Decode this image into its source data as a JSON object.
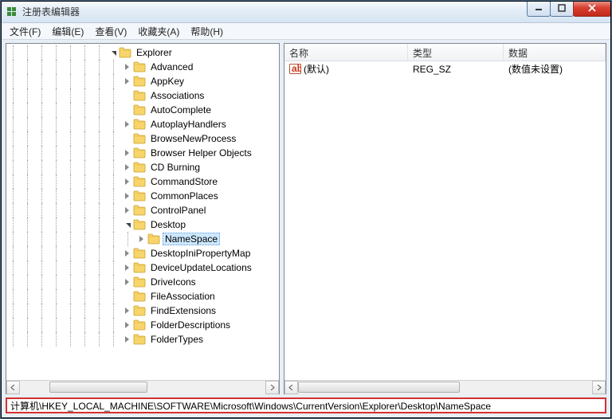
{
  "window": {
    "title": "注册表编辑器"
  },
  "menu": [
    {
      "label": "文件(F)"
    },
    {
      "label": "编辑(E)"
    },
    {
      "label": "查看(V)"
    },
    {
      "label": "收藏夹(A)"
    },
    {
      "label": "帮助(H)"
    }
  ],
  "tree": {
    "root": {
      "label": "Explorer",
      "expanded": true,
      "children": [
        {
          "label": "Advanced",
          "expandable": true
        },
        {
          "label": "AppKey",
          "expandable": true
        },
        {
          "label": "Associations",
          "expandable": false
        },
        {
          "label": "AutoComplete",
          "expandable": false
        },
        {
          "label": "AutoplayHandlers",
          "expandable": true
        },
        {
          "label": "BrowseNewProcess",
          "expandable": false
        },
        {
          "label": "Browser Helper Objects",
          "expandable": true
        },
        {
          "label": "CD Burning",
          "expandable": true
        },
        {
          "label": "CommandStore",
          "expandable": true
        },
        {
          "label": "CommonPlaces",
          "expandable": true
        },
        {
          "label": "ControlPanel",
          "expandable": true
        },
        {
          "label": "Desktop",
          "expandable": true,
          "expanded": true,
          "children": [
            {
              "label": "NameSpace",
              "expandable": true,
              "selected": true
            }
          ]
        },
        {
          "label": "DesktopIniPropertyMap",
          "expandable": true
        },
        {
          "label": "DeviceUpdateLocations",
          "expandable": true
        },
        {
          "label": "DriveIcons",
          "expandable": true
        },
        {
          "label": "FileAssociation",
          "expandable": false
        },
        {
          "label": "FindExtensions",
          "expandable": true
        },
        {
          "label": "FolderDescriptions",
          "expandable": true
        },
        {
          "label": "FolderTypes",
          "expandable": true
        }
      ]
    }
  },
  "list": {
    "headers": {
      "name": "名称",
      "type": "类型",
      "data": "数据"
    },
    "rows": [
      {
        "name": "(默认)",
        "type": "REG_SZ",
        "data": "(数值未设置)"
      }
    ]
  },
  "statusbar": "计算机\\HKEY_LOCAL_MACHINE\\SOFTWARE\\Microsoft\\Windows\\CurrentVersion\\Explorer\\Desktop\\NameSpace",
  "colors": {
    "selection": "#cde8ff",
    "highlight_border": "#d63030"
  },
  "scrollbars": {
    "left_thumb": {
      "left_pct": 12,
      "width_pct": 40
    },
    "right_thumb": {
      "left_pct": 0,
      "width_pct": 55
    }
  }
}
